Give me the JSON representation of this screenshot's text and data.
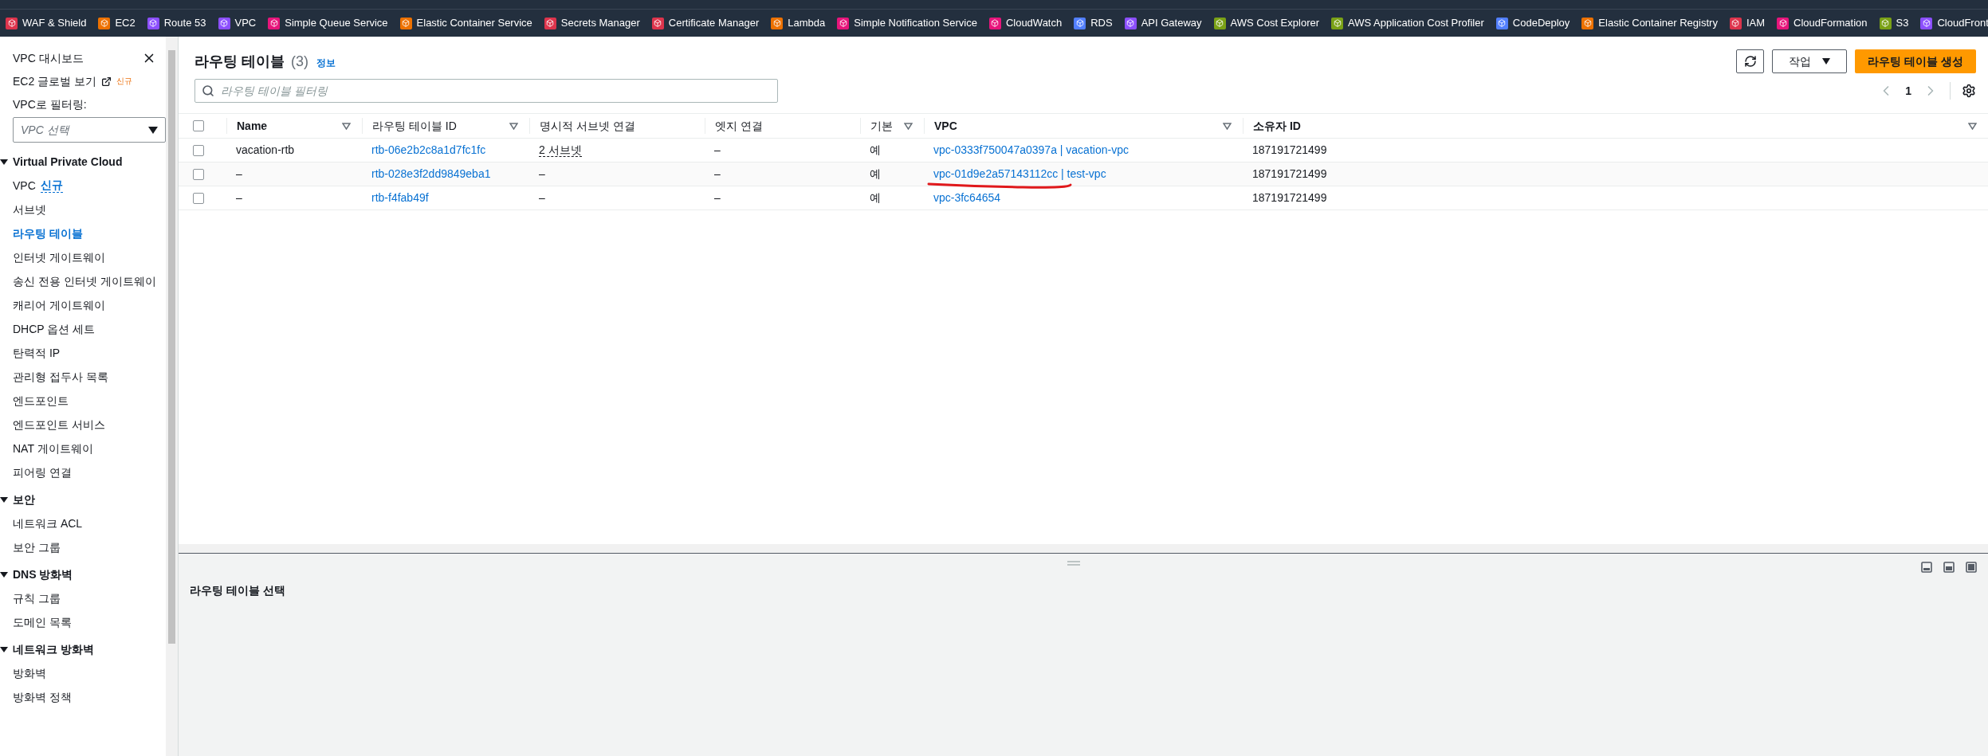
{
  "bookmarks": [
    {
      "label": "WAF & Shield",
      "color": "#dd344c"
    },
    {
      "label": "EC2",
      "color": "#ed7100"
    },
    {
      "label": "Route 53",
      "color": "#8c4fff"
    },
    {
      "label": "VPC",
      "color": "#8c4fff"
    },
    {
      "label": "Simple Queue Service",
      "color": "#e7157b"
    },
    {
      "label": "Elastic Container Service",
      "color": "#ed7100"
    },
    {
      "label": "Secrets Manager",
      "color": "#dd344c"
    },
    {
      "label": "Certificate Manager",
      "color": "#dd344c"
    },
    {
      "label": "Lambda",
      "color": "#ed7100"
    },
    {
      "label": "Simple Notification Service",
      "color": "#e7157b"
    },
    {
      "label": "CloudWatch",
      "color": "#e7157b"
    },
    {
      "label": "RDS",
      "color": "#527fff"
    },
    {
      "label": "API Gateway",
      "color": "#8c4fff"
    },
    {
      "label": "AWS Cost Explorer",
      "color": "#7aa116"
    },
    {
      "label": "AWS Application Cost Profiler",
      "color": "#7aa116"
    },
    {
      "label": "CodeDeploy",
      "color": "#527fff"
    },
    {
      "label": "Elastic Container Registry",
      "color": "#ed7100"
    },
    {
      "label": "IAM",
      "color": "#dd344c"
    },
    {
      "label": "CloudFormation",
      "color": "#e7157b"
    },
    {
      "label": "S3",
      "color": "#7aa116"
    },
    {
      "label": "CloudFront",
      "color": "#8c4fff"
    }
  ],
  "sidebar": {
    "title": "VPC 대시보드",
    "global_view": {
      "label": "EC2 글로벌 보기",
      "badge": "신규"
    },
    "filter_label": "VPC로 필터링:",
    "filter": {
      "placeholder": "VPC 선택"
    },
    "sections": [
      {
        "title": "Virtual Private Cloud",
        "expanded": true,
        "items": [
          {
            "label": "VPC",
            "badge": "신규",
            "selected": false
          },
          {
            "label": "서브넷",
            "selected": false
          },
          {
            "label": "라우팅 테이블",
            "selected": true
          },
          {
            "label": "인터넷 게이트웨이",
            "selected": false
          },
          {
            "label": "송신 전용 인터넷 게이트웨이",
            "selected": false
          },
          {
            "label": "캐리어 게이트웨이",
            "selected": false
          },
          {
            "label": "DHCP 옵션 세트",
            "selected": false
          },
          {
            "label": "탄력적 IP",
            "selected": false
          },
          {
            "label": "관리형 접두사 목록",
            "selected": false
          },
          {
            "label": "엔드포인트",
            "selected": false
          },
          {
            "label": "엔드포인트 서비스",
            "selected": false
          },
          {
            "label": "NAT 게이트웨이",
            "selected": false
          },
          {
            "label": "피어링 연결",
            "selected": false
          }
        ]
      },
      {
        "title": "보안",
        "expanded": true,
        "items": [
          {
            "label": "네트워크 ACL",
            "selected": false
          },
          {
            "label": "보안 그룹",
            "selected": false
          }
        ]
      },
      {
        "title": "DNS 방화벽",
        "expanded": true,
        "items": [
          {
            "label": "규칙 그룹",
            "selected": false
          },
          {
            "label": "도메인 목록",
            "selected": false
          }
        ]
      },
      {
        "title": "네트워크 방화벽",
        "expanded": true,
        "items": [
          {
            "label": "방화벽",
            "selected": false
          },
          {
            "label": "방화벽 정책",
            "selected": false
          }
        ]
      }
    ]
  },
  "header": {
    "title": "라우팅 테이블",
    "count": "(3)",
    "info": "정보",
    "actions": "작업",
    "create": "라우팅 테이블 생성",
    "search": {
      "placeholder": "라우팅 테이블 필터링"
    },
    "page": "1"
  },
  "table": {
    "select_all": {
      "checked": false
    },
    "columns": [
      {
        "label": "Name",
        "sortable": true
      },
      {
        "label": "라우팅 테이블 ID",
        "sortable": true
      },
      {
        "label": "명시적 서브넷 연결",
        "sortable": false
      },
      {
        "label": "엣지 연결",
        "sortable": false
      },
      {
        "label": "기본",
        "sortable": true
      },
      {
        "label": "VPC",
        "sortable": true
      },
      {
        "label": "소유자 ID",
        "sortable": true
      }
    ],
    "rows": [
      {
        "checked": false,
        "underlined": false,
        "name": "vacation-rtb",
        "id": "rtb-06e2b2c8a1d7fc1fc",
        "subnets": "2 서브넷",
        "edge": "–",
        "main": "예",
        "vpc": "vpc-0333f750047a0397a | vacation-vpc",
        "owner": "187191721499"
      },
      {
        "checked": false,
        "underlined": true,
        "name": "–",
        "id": "rtb-028e3f2dd9849eba1",
        "subnets": "–",
        "edge": "–",
        "main": "예",
        "vpc": "vpc-01d9e2a57143112cc | test-vpc",
        "owner": "187191721499"
      },
      {
        "checked": false,
        "underlined": false,
        "name": "–",
        "id": "rtb-f4fab49f",
        "subnets": "–",
        "edge": "–",
        "main": "예",
        "vpc": "vpc-3fc64654",
        "owner": "187191721499"
      }
    ]
  },
  "details": {
    "title": "라우팅 테이블 선택"
  }
}
